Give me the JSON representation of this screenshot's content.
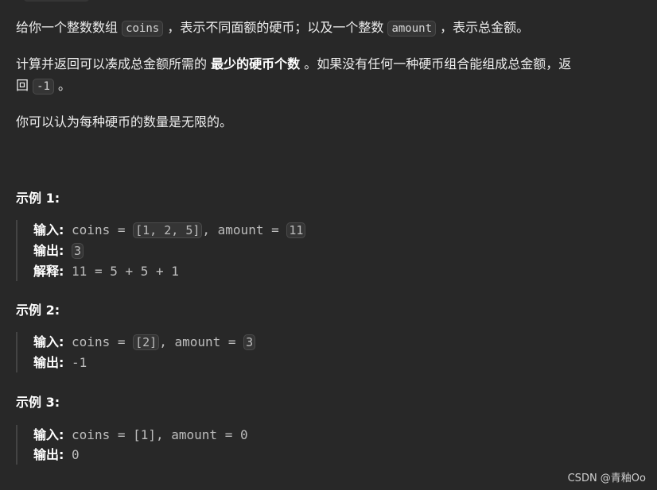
{
  "description": {
    "p1": {
      "t1": "给你一个整数数组 ",
      "c1": "coins",
      "t2": " ，表示不同面额的硬币；以及一个整数 ",
      "c2": "amount",
      "t3": " ，表示总金额。"
    },
    "p2": {
      "t1": "计算并返回可以凑成总金额所需的 ",
      "bold": "最少的硬币个数",
      "t2": " 。如果没有任何一种硬币组合能组成总金额，返",
      "t3": "回 ",
      "c1": "-1",
      "t4": " 。"
    },
    "p3": "你可以认为每种硬币的数量是无限的。"
  },
  "examples": [
    {
      "title": "示例 1:",
      "input_label": "输入:",
      "input_pre": " coins = ",
      "coins": "[1, 2, 5]",
      "input_mid": ", amount = ",
      "amount": "11",
      "output_label": "输出:",
      "output": "3",
      "explain_label": "解释:",
      "explain": " 11 = 5 + 5 + 1"
    },
    {
      "title": "示例 2:",
      "input_label": "输入:",
      "input_pre": " coins = ",
      "coins": "[2]",
      "input_mid": ", amount = ",
      "amount": "3",
      "output_label": "输出:",
      "output": " -1"
    },
    {
      "title": "示例 3:",
      "input_label": "输入:",
      "input_text": " coins = [1], amount = 0",
      "output_label": "输出:",
      "output": " 0"
    }
  ],
  "watermark": "CSDN @青釉Oo"
}
